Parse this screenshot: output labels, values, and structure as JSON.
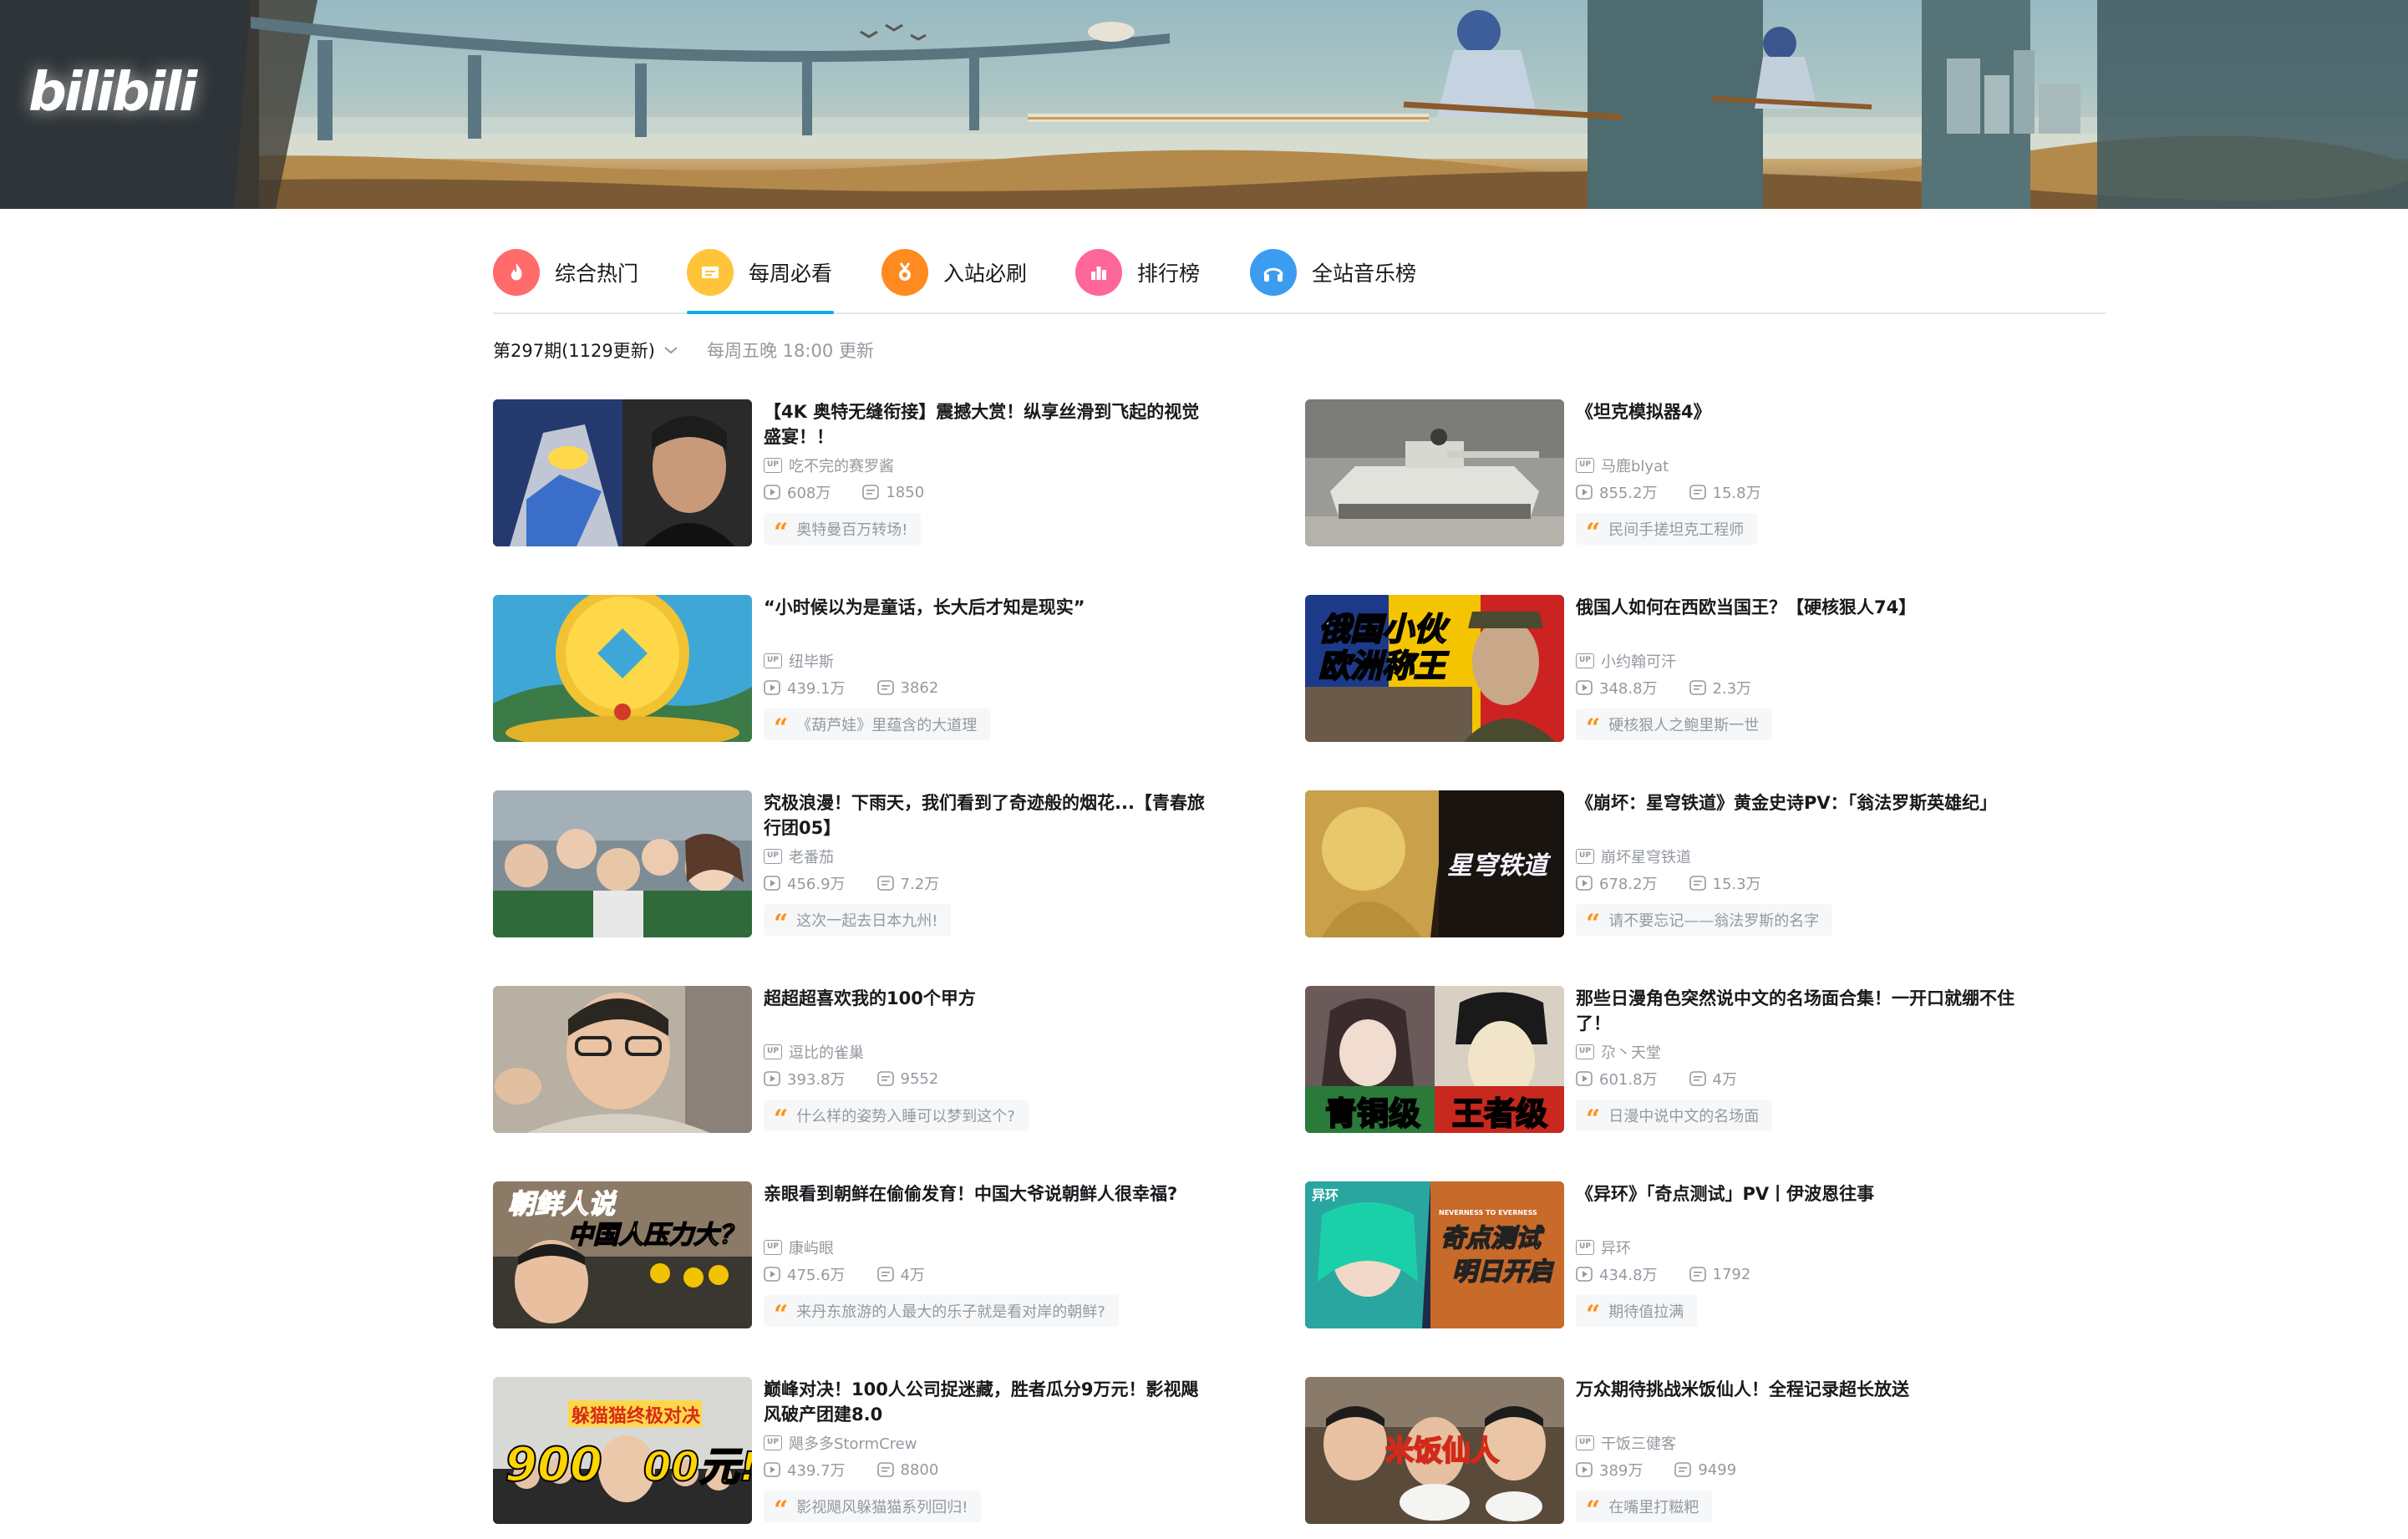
{
  "brand": {
    "logo_text": "bilibili"
  },
  "tabs": [
    {
      "label": "综合热门",
      "icon": "flame-icon",
      "color": "#ff6b6b"
    },
    {
      "label": "每周必看",
      "icon": "ticket-icon",
      "color": "#ffc43a"
    },
    {
      "label": "入站必刷",
      "icon": "medal-icon",
      "color": "#ff8a1f"
    },
    {
      "label": "排行榜",
      "icon": "ranking-icon",
      "color": "#ff6699"
    },
    {
      "label": "全站音乐榜",
      "icon": "headphones-icon",
      "color": "#3b9cf0"
    }
  ],
  "active_tab": "每周必看",
  "accent_color": "#00aeec",
  "issue": {
    "label": "第297期(1129更新)",
    "note": "每周五晚 18:00 更新"
  },
  "videos": [
    {
      "title_line1": "【4K 奥特无缝衔接】震撼大赏！纵享丝滑到飞起的视觉",
      "title_line2": "盛宴！！",
      "up": "吃不完的赛罗酱",
      "views": "608万",
      "danmaku": "1850",
      "comment": "奥特曼百万转场!"
    },
    {
      "title_line1": "《坦克模拟器4》",
      "title_line2": "",
      "up": "马鹿blyat",
      "views": "855.2万",
      "danmaku": "15.8万",
      "comment": "民间手搓坦克工程师"
    },
    {
      "title_line1": "“小时候以为是童话，长大后才知是现实”",
      "title_line2": "",
      "up": "纽毕斯",
      "views": "439.1万",
      "danmaku": "3862",
      "comment": "《葫芦娃》里蕴含的大道理"
    },
    {
      "title_line1": "俄国人如何在西欧当国王？【硬核狠人74】",
      "title_line2": "",
      "up": "小约翰可汗",
      "views": "348.8万",
      "danmaku": "2.3万",
      "comment": "硬核狠人之鲍里斯一世"
    },
    {
      "title_line1": "究极浪漫！下雨天，我们看到了奇迹般的烟花...【青春旅",
      "title_line2": "行团05】",
      "up": "老番茄",
      "views": "456.9万",
      "danmaku": "7.2万",
      "comment": "这次一起去日本九州!"
    },
    {
      "title_line1": "《崩坏：星穹铁道》黄金史诗PV：「翁法罗斯英雄纪」",
      "title_line2": "",
      "up": "崩坏星穹铁道",
      "views": "678.2万",
      "danmaku": "15.3万",
      "comment": "请不要忘记——翁法罗斯的名字"
    },
    {
      "title_line1": "超超超喜欢我的100个甲方",
      "title_line2": "",
      "up": "逗比的雀巢",
      "views": "393.8万",
      "danmaku": "9552",
      "comment": "什么样的姿势入睡可以梦到这个?"
    },
    {
      "title_line1": "那些日漫角色突然说中文的名场面合集！一开口就绷不住",
      "title_line2": "了！",
      "up": "尕丶天堂",
      "views": "601.8万",
      "danmaku": "4万",
      "comment": "日漫中说中文的名场面"
    },
    {
      "title_line1": "亲眼看到朝鲜在偷偷发育！中国大爷说朝鲜人很幸福?",
      "title_line2": "",
      "up": "康屿眼",
      "views": "475.6万",
      "danmaku": "4万",
      "comment": "来丹东旅游的人最大的乐子就是看对岸的朝鲜?"
    },
    {
      "title_line1": "《异环》「奇点测试」PV丨伊波恩往事",
      "title_line2": "",
      "up": "异环",
      "views": "434.8万",
      "danmaku": "1792",
      "comment": "期待值拉满"
    },
    {
      "title_line1": "巅峰对决！100人公司捉迷藏，胜者瓜分9万元！影视飓",
      "title_line2": "风破产团建8.0",
      "up": "飓多多StormCrew",
      "views": "439.7万",
      "danmaku": "8800",
      "comment": "影视飓风躲猫猫系列回归!"
    },
    {
      "title_line1": "万众期待挑战米饭仙人！全程记录超长放送",
      "title_line2": "",
      "up": "干饭三健客",
      "views": "389万",
      "danmaku": "9499",
      "comment": "在嘴里打糍粑"
    }
  ],
  "thumb_texts": {
    "t4": [
      "俄国小伙",
      "欧洲称王"
    ],
    "t6": "星穹铁道",
    "t8": [
      "青铜级",
      "王者级"
    ],
    "t9": [
      "朝鲜人说",
      "中国人压力大？"
    ],
    "t10": [
      "异环",
      "奇点测试",
      "明日开启",
      "NEVERNESS TO EVERNESS"
    ],
    "t11": [
      "躲猫猫终极对决",
      "900",
      "00元!"
    ],
    "t12": "米饭仙人"
  }
}
